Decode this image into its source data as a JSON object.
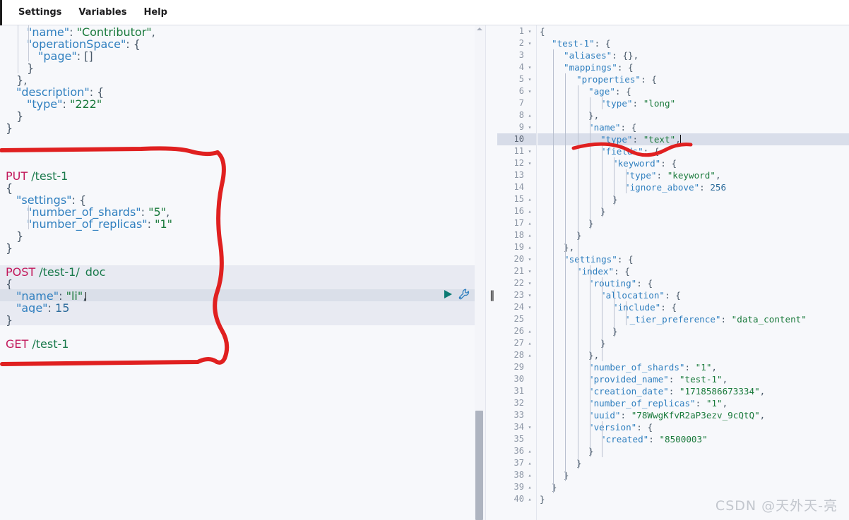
{
  "menubar": {
    "items": [
      {
        "label": "Settings",
        "name": "menu-settings"
      },
      {
        "label": "Variables",
        "name": "menu-variables"
      },
      {
        "label": "Help",
        "name": "menu-help"
      }
    ]
  },
  "colors": {
    "method": "#c2185b",
    "url": "#1a7a4c",
    "key": "#2f7fbf",
    "string": "#1a7a3c",
    "annotation": "#e02020",
    "run": "#0b7a73",
    "wrench": "#2f7fbf",
    "current_line": "#dadfe9",
    "selected_block": "#e8eaf2",
    "background": "#f7f8fb"
  },
  "left_editor": {
    "name": "request-console-editor",
    "lines": [
      {
        "indent": 2,
        "text": "\"name\": \"Contributor\","
      },
      {
        "indent": 2,
        "text": "\"operationSpace\": {"
      },
      {
        "indent": 3,
        "text": "\"page\": []"
      },
      {
        "indent": 2,
        "text": "}"
      },
      {
        "indent": 1,
        "text": "},"
      },
      {
        "indent": 1,
        "text": "\"description\": {"
      },
      {
        "indent": 2,
        "text": "\"type\": \"222\""
      },
      {
        "indent": 1,
        "text": "}"
      },
      {
        "indent": 0,
        "text": "}"
      },
      {
        "indent": 0,
        "text": ""
      },
      {
        "indent": 0,
        "text": ""
      },
      {
        "indent": 0,
        "text": ""
      },
      {
        "indent": 0,
        "text": "PUT /test-1"
      },
      {
        "indent": 0,
        "text": "{"
      },
      {
        "indent": 1,
        "text": "\"settings\": {"
      },
      {
        "indent": 2,
        "text": "\"number_of_shards\": \"5\","
      },
      {
        "indent": 2,
        "text": "\"number_of_replicas\": \"1\""
      },
      {
        "indent": 1,
        "text": "}"
      },
      {
        "indent": 0,
        "text": "}"
      },
      {
        "indent": 0,
        "text": ""
      },
      {
        "indent": 0,
        "text": "POST /test-1/_doc"
      },
      {
        "indent": 0,
        "text": "{"
      },
      {
        "indent": 1,
        "text": "\"name\": \"li\","
      },
      {
        "indent": 1,
        "text": "\"age\": 15"
      },
      {
        "indent": 0,
        "text": "}"
      },
      {
        "indent": 0,
        "text": ""
      },
      {
        "indent": 0,
        "text": "GET /test-1"
      }
    ],
    "requests": [
      {
        "method": "PUT",
        "path": "/test-1"
      },
      {
        "method": "POST",
        "path": "/test-1/_doc"
      },
      {
        "method": "GET",
        "path": "/test-1"
      }
    ],
    "active_request": "POST /test-1/_doc",
    "cursor_line_text": "\"name\": \"li\",",
    "run_button": {
      "name": "run-request-button",
      "glyph": "play-icon"
    },
    "wrench_button": {
      "name": "request-actions-wrench-icon"
    }
  },
  "right_editor": {
    "name": "response-viewer",
    "total_lines": 40,
    "highlighted_line": 10,
    "lines": [
      {
        "n": 1,
        "fold": "down",
        "indent": 0,
        "text": "{"
      },
      {
        "n": 2,
        "fold": "down",
        "indent": 1,
        "text": "\"test-1\": {"
      },
      {
        "n": 3,
        "fold": "",
        "indent": 2,
        "text": "\"aliases\": {},"
      },
      {
        "n": 4,
        "fold": "down",
        "indent": 2,
        "text": "\"mappings\": {"
      },
      {
        "n": 5,
        "fold": "down",
        "indent": 3,
        "text": "\"properties\": {"
      },
      {
        "n": 6,
        "fold": "down",
        "indent": 4,
        "text": "\"age\": {"
      },
      {
        "n": 7,
        "fold": "",
        "indent": 5,
        "text": "\"type\": \"long\""
      },
      {
        "n": 8,
        "fold": "up",
        "indent": 4,
        "text": "},"
      },
      {
        "n": 9,
        "fold": "down",
        "indent": 4,
        "text": "\"name\": {"
      },
      {
        "n": 10,
        "fold": "",
        "indent": 5,
        "text": "\"type\": \"text\","
      },
      {
        "n": 11,
        "fold": "down",
        "indent": 5,
        "text": "\"fields\": {"
      },
      {
        "n": 12,
        "fold": "down",
        "indent": 6,
        "text": "\"keyword\": {"
      },
      {
        "n": 13,
        "fold": "",
        "indent": 7,
        "text": "\"type\": \"keyword\","
      },
      {
        "n": 14,
        "fold": "",
        "indent": 7,
        "text": "\"ignore_above\": 256"
      },
      {
        "n": 15,
        "fold": "up",
        "indent": 6,
        "text": "}"
      },
      {
        "n": 16,
        "fold": "up",
        "indent": 5,
        "text": "}"
      },
      {
        "n": 17,
        "fold": "up",
        "indent": 4,
        "text": "}"
      },
      {
        "n": 18,
        "fold": "up",
        "indent": 3,
        "text": "}"
      },
      {
        "n": 19,
        "fold": "up",
        "indent": 2,
        "text": "},"
      },
      {
        "n": 20,
        "fold": "down",
        "indent": 2,
        "text": "\"settings\": {"
      },
      {
        "n": 21,
        "fold": "down",
        "indent": 3,
        "text": "\"index\": {"
      },
      {
        "n": 22,
        "fold": "down",
        "indent": 4,
        "text": "\"routing\": {"
      },
      {
        "n": 23,
        "fold": "down",
        "indent": 5,
        "text": "\"allocation\": {"
      },
      {
        "n": 24,
        "fold": "down",
        "indent": 6,
        "text": "\"include\": {"
      },
      {
        "n": 25,
        "fold": "",
        "indent": 7,
        "text": "\"_tier_preference\": \"data_content\""
      },
      {
        "n": 26,
        "fold": "up",
        "indent": 6,
        "text": "}"
      },
      {
        "n": 27,
        "fold": "up",
        "indent": 5,
        "text": "}"
      },
      {
        "n": 28,
        "fold": "up",
        "indent": 4,
        "text": "},"
      },
      {
        "n": 29,
        "fold": "",
        "indent": 4,
        "text": "\"number_of_shards\": \"1\","
      },
      {
        "n": 30,
        "fold": "",
        "indent": 4,
        "text": "\"provided_name\": \"test-1\","
      },
      {
        "n": 31,
        "fold": "",
        "indent": 4,
        "text": "\"creation_date\": \"1718586673334\","
      },
      {
        "n": 32,
        "fold": "",
        "indent": 4,
        "text": "\"number_of_replicas\": \"1\","
      },
      {
        "n": 33,
        "fold": "",
        "indent": 4,
        "text": "\"uuid\": \"78WwgKfvR2aP3ezv_9cQtQ\","
      },
      {
        "n": 34,
        "fold": "down",
        "indent": 4,
        "text": "\"version\": {"
      },
      {
        "n": 35,
        "fold": "",
        "indent": 5,
        "text": "\"created\": \"8500003\""
      },
      {
        "n": 36,
        "fold": "up",
        "indent": 4,
        "text": "}"
      },
      {
        "n": 37,
        "fold": "up",
        "indent": 3,
        "text": "}"
      },
      {
        "n": 38,
        "fold": "up",
        "indent": 2,
        "text": "}"
      },
      {
        "n": 39,
        "fold": "up",
        "indent": 1,
        "text": "}"
      },
      {
        "n": 40,
        "fold": "up",
        "indent": 0,
        "text": "}"
      }
    ]
  },
  "splitter": {
    "name": "pane-splitter",
    "glyph": "‖"
  },
  "left_scrollbar": {
    "name": "left-editor-scrollbar"
  },
  "annotations": {
    "name": "red-ink-annotations",
    "shapes": [
      {
        "kind": "bracket",
        "desc": "large red bracket around PUT/POST/GET request block"
      },
      {
        "kind": "underline",
        "desc": "red squiggle under line 10 type text"
      }
    ]
  },
  "watermark": {
    "text": "CSDN @天外天-亮"
  }
}
